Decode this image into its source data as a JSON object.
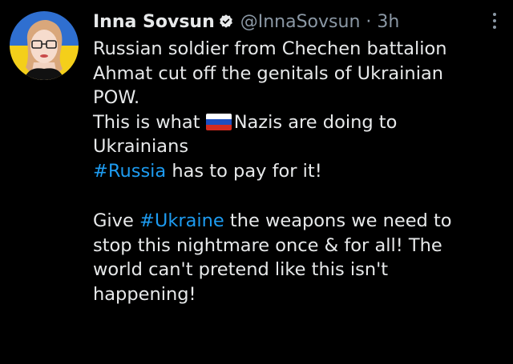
{
  "tweet": {
    "author": {
      "display_name": "Inna Sovsun",
      "handle": "@InnaSovsun",
      "separator": "·",
      "timestamp": "3h",
      "verified": true,
      "avatar_icon": "user-avatar-photo",
      "avatar_colors": {
        "top": "#2f6fd0",
        "bottom": "#f4cf1a"
      }
    },
    "more_icon": "more-vertical-icon",
    "body": {
      "line1": "Russian soldier from Chechen battalion",
      "line2": "Ahmat cut off the genitals of Ukrainian",
      "line3": "POW.",
      "line4_before_flag": "This is what ",
      "flag_icon": "russia-flag-emoji",
      "line4_after_flag": "Nazis are doing to",
      "line5": "Ukrainians",
      "line6_hashtag": "#Russia",
      "line6_rest": " has to pay for it!",
      "line7_before": "Give ",
      "line7_hashtag": "#Ukraine",
      "line7_after": " the weapons we need to",
      "line8": "stop this nightmare once & for all! The",
      "line9": "world can't pretend like this isn't",
      "line10": "happening!"
    },
    "colors": {
      "background": "#000000",
      "text": "#e7e9ea",
      "secondary_text": "#8b98a5",
      "link": "#1d9bf0",
      "verified_badge": "#e7e9ea"
    }
  }
}
